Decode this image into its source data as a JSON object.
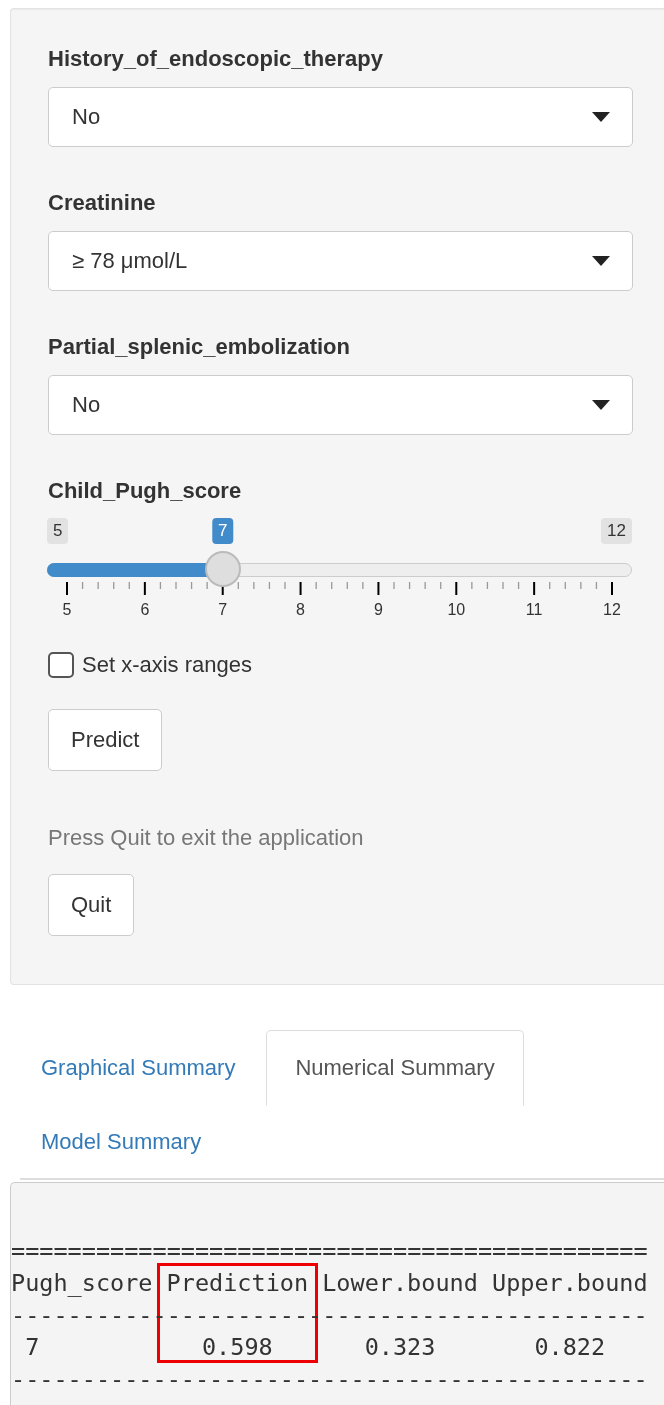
{
  "inputs": [
    {
      "kind": "select",
      "label": "History_of_endoscopic_therapy",
      "value": "No"
    },
    {
      "kind": "select",
      "label": "Creatinine",
      "value": "≥ 78 μmol/L"
    },
    {
      "kind": "select",
      "label": "Partial_splenic_embolization",
      "value": "No"
    },
    {
      "kind": "slider",
      "label": "Child_Pugh_score",
      "min": "5",
      "max": "12",
      "value": "7",
      "level": 0.2857,
      "ticks": [
        "5",
        "6",
        "7",
        "8",
        "9",
        "10",
        "11",
        "12"
      ]
    }
  ],
  "checkbox": {
    "label": "Set x-axis ranges",
    "checked": false
  },
  "predict_button": "Predict",
  "help_text": "Press Quit to exit the application",
  "quit_button": "Quit",
  "tabs": [
    {
      "label": "Graphical Summary",
      "selected": false
    },
    {
      "label": "Numerical Summary",
      "selected": true
    },
    {
      "label": "Model Summary",
      "selected": false
    }
  ],
  "output": {
    "top_rule": "=============================================",
    "mid_rule": "---------------------------------------------",
    "bottom_rule": "---------------------------------------------",
    "columns": [
      {
        "header": "Pugh_score",
        "value": "7",
        "highlighted": false
      },
      {
        "header": "Prediction",
        "value": "0.598",
        "highlighted": true
      },
      {
        "header": "Lower.bound",
        "value": "0.323",
        "highlighted": false
      },
      {
        "header": "Upper.bound",
        "value": "0.822",
        "highlighted": false
      }
    ]
  }
}
